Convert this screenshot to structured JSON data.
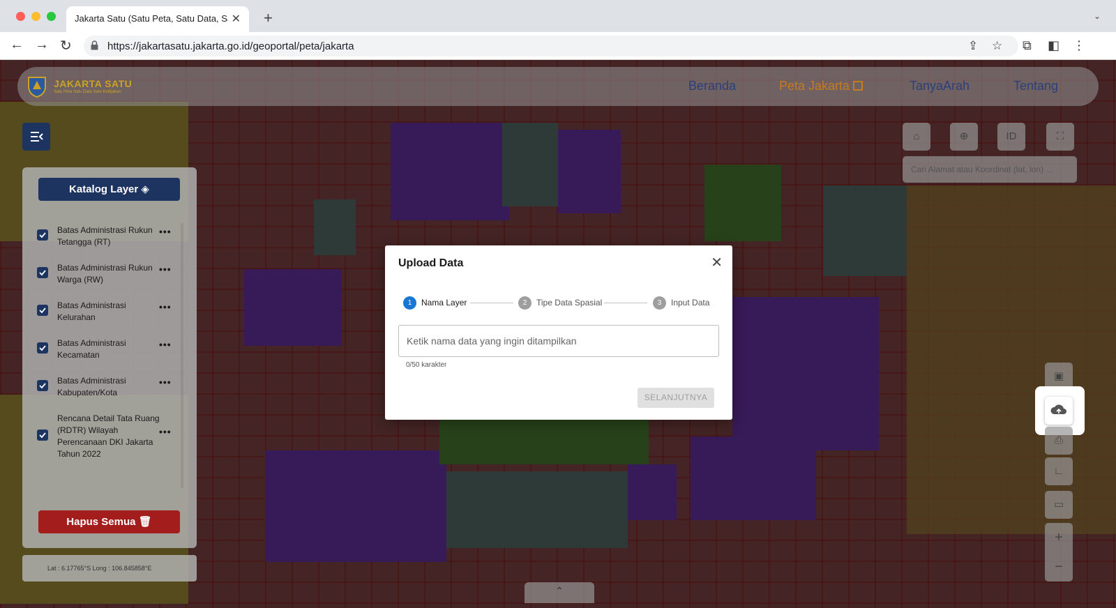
{
  "browser": {
    "tab_title": "Jakarta Satu (Satu Peta, Satu Data, Sa",
    "url": "https://jakartasatu.jakarta.go.id/geoportal/peta/jakarta"
  },
  "header": {
    "logo_text": "JAKARTA SATU",
    "logo_tagline": "Satu Peta Satu Data Satu Kebijakan",
    "nav": [
      {
        "label": "Beranda"
      },
      {
        "label": "Peta Jakarta"
      },
      {
        "label": "TanyaArah"
      },
      {
        "label": "Tentang"
      }
    ]
  },
  "left_panel": {
    "katalog_label": "Katalog Layer",
    "layers": [
      {
        "label": "Batas Administrasi Rukun Tetangga (RT)",
        "checked": true
      },
      {
        "label": "Batas Administrasi Rukun Warga (RW)",
        "checked": true
      },
      {
        "label": "Batas Administrasi Kelurahan",
        "checked": true
      },
      {
        "label": "Batas Administrasi Kecamatan",
        "checked": true
      },
      {
        "label": "Batas Administrasi Kabupaten/Kota",
        "checked": true
      },
      {
        "label": "Rencana Detail Tata Ruang (RDTR) Wilayah Perencanaan DKI Jakarta Tahun 2022",
        "checked": true
      }
    ],
    "more_label": "•••",
    "hapus_label": "Hapus Semua"
  },
  "coords": {
    "text": "Lat :  6.17765°S   Long :  106.845858°E"
  },
  "right_controls": {
    "lang_label": "ID",
    "search_placeholder": "Cari Alamat atau Koordinat (lat, lon) ..."
  },
  "modal": {
    "title": "Upload Data",
    "steps": [
      {
        "number": "1",
        "label": "Nama Layer",
        "active": true
      },
      {
        "number": "2",
        "label": "Tipe Data Spasial",
        "active": false
      },
      {
        "number": "3",
        "label": "Input Data",
        "active": false
      }
    ],
    "input_placeholder": "Ketik nama data yang ingin ditampilkan",
    "input_value": "",
    "char_count": "0/50 karakter",
    "next_label": "SELANJUTNYA"
  },
  "colors": {
    "navy": "#1d3461",
    "danger": "#a31d1d",
    "step_active": "#1976d2",
    "step_inactive": "#9e9e9e",
    "nav_active": "#c57b1e"
  }
}
